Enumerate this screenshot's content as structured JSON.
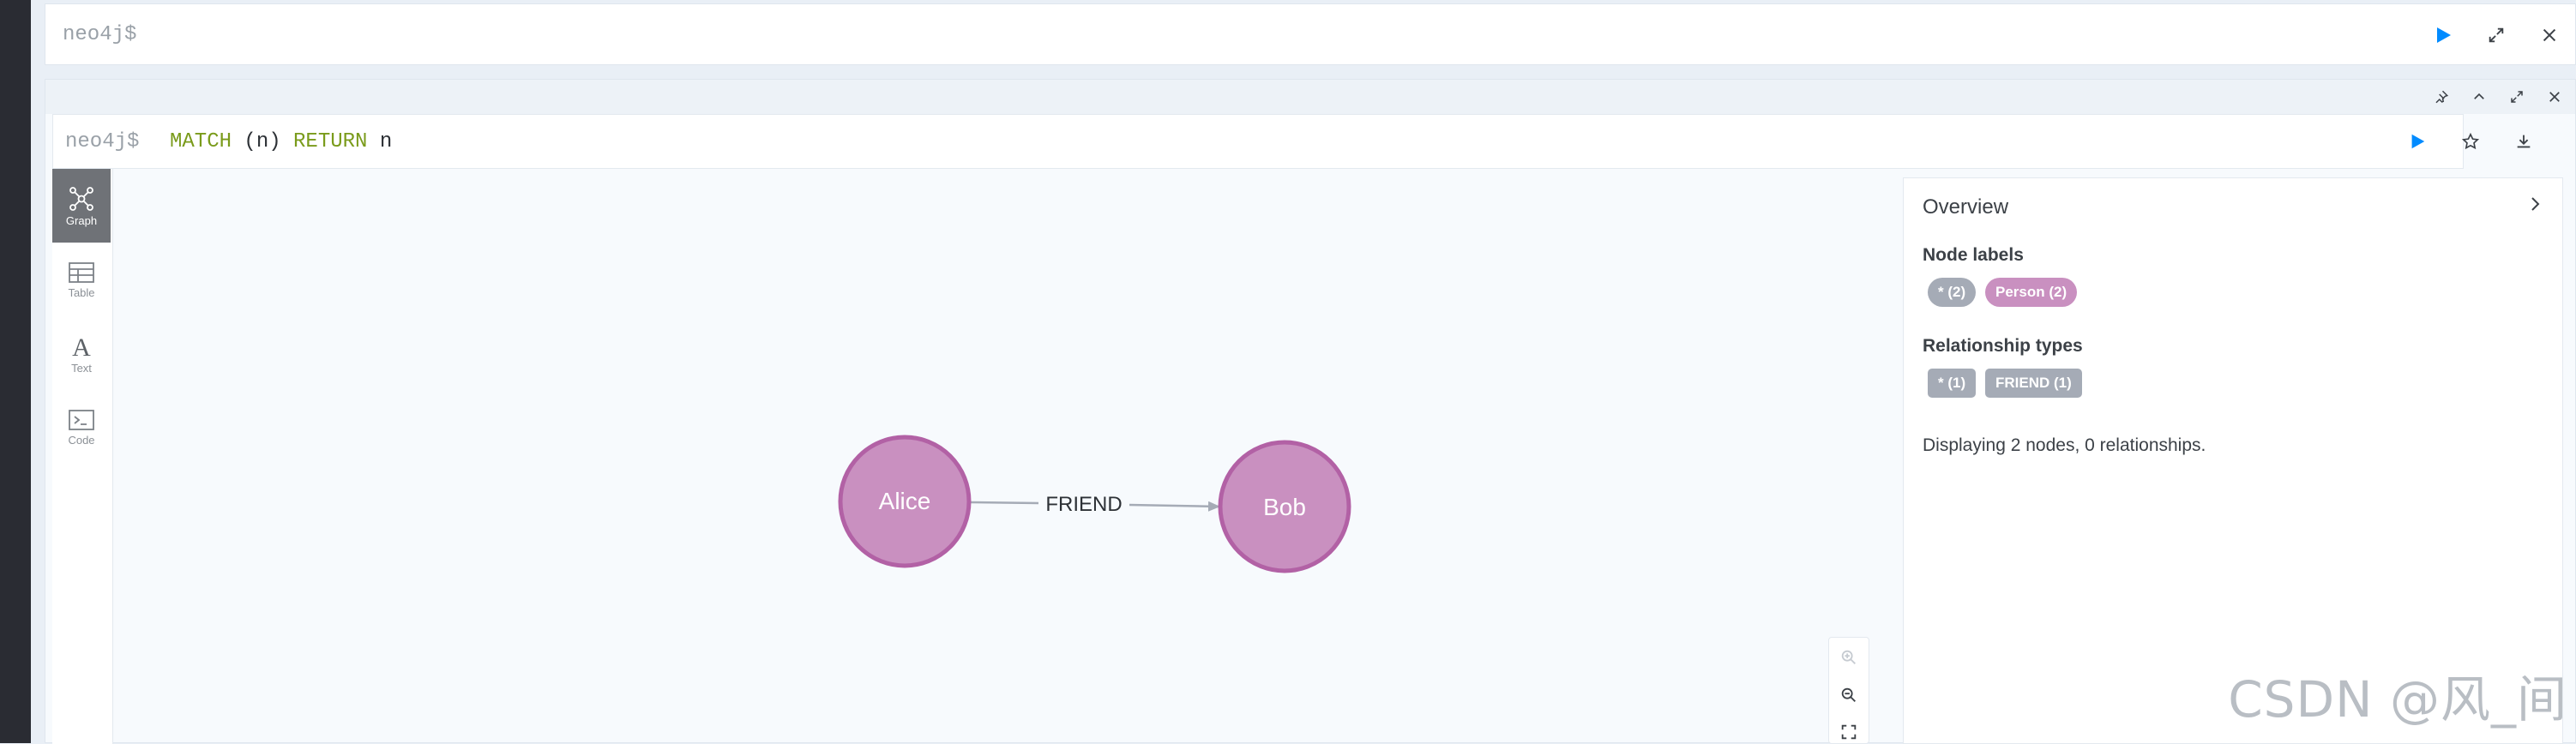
{
  "top_editor": {
    "prompt": "neo4j$"
  },
  "frame": {
    "prompt": "neo4j$",
    "query": {
      "kw1": "MATCH",
      "mid": " (n) ",
      "kw2": "RETURN",
      "tail": " n"
    }
  },
  "tabs": [
    {
      "label": "Graph",
      "icon": "graph-icon",
      "active": true
    },
    {
      "label": "Table",
      "icon": "table-icon"
    },
    {
      "label": "Text",
      "icon": "text-icon"
    },
    {
      "label": "Code",
      "icon": "code-icon"
    }
  ],
  "graph": {
    "nodes": [
      {
        "id": "alice",
        "label": "Alice",
        "color": "#c990c0",
        "border": "#b261a5"
      },
      {
        "id": "bob",
        "label": "Bob",
        "color": "#c990c0",
        "border": "#b261a5"
      }
    ],
    "relationship": {
      "from": "alice",
      "to": "bob",
      "label": "FRIEND"
    }
  },
  "overview": {
    "title": "Overview",
    "node_labels_heading": "Node labels",
    "node_labels": [
      {
        "text": "* (2)",
        "color": "#a5abb6"
      },
      {
        "text": "Person (2)",
        "color": "#c990c0"
      }
    ],
    "rel_types_heading": "Relationship types",
    "rel_types": [
      {
        "text": "* (1)",
        "color": "#a5abb6"
      },
      {
        "text": "FRIEND (1)",
        "color": "#a5abb6"
      }
    ],
    "status": "Displaying 2 nodes, 0 relationships."
  },
  "watermark": "CSDN @风_间",
  "colors": {
    "accent": "#018bff",
    "rail": "#2a2c33"
  }
}
